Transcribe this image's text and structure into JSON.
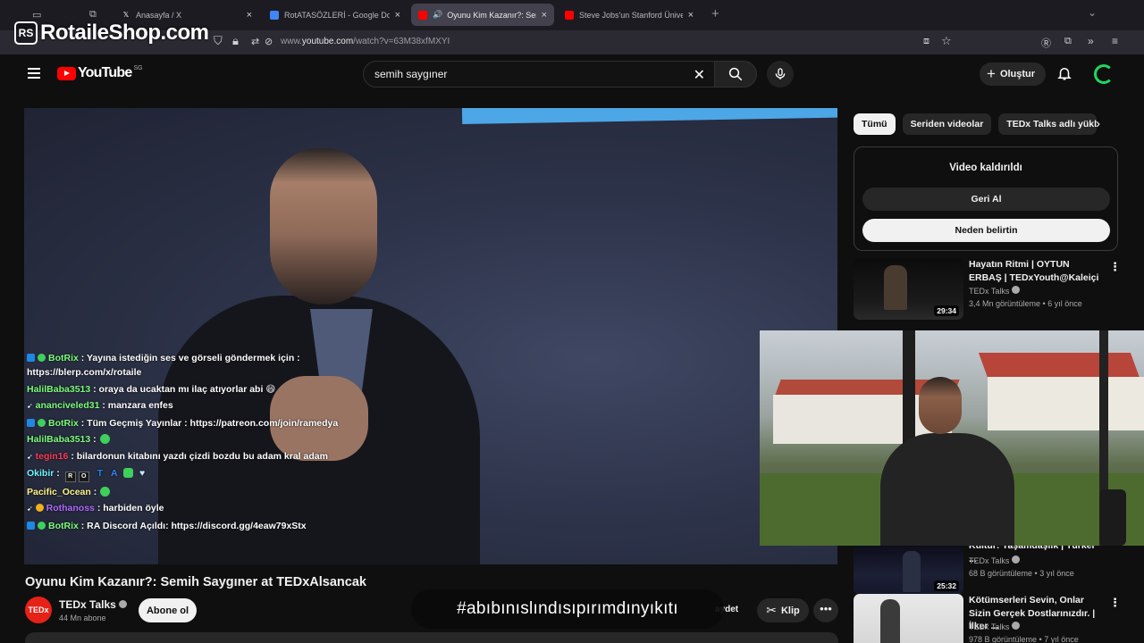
{
  "browser": {
    "tabs": [
      {
        "title": "Anasayfa / X",
        "favicon": "x-logo"
      },
      {
        "title": "RotATASÖZLERİ - Google Doküman",
        "favicon": "google-docs"
      },
      {
        "title": "Oyunu Kim Kazanır?: Semih",
        "favicon": "youtube",
        "active": true
      },
      {
        "title": "Steve Jobs'un Stanford Üniversitesi",
        "favicon": "youtube"
      }
    ],
    "url_prefix": "www.",
    "url_domain": "youtube.com",
    "url_path": "/watch?v=63M38xfMXYI"
  },
  "watermark": {
    "badge": "RS",
    "text": "RotaileShop.com"
  },
  "youtube": {
    "logo_text": "YouTube",
    "logo_country": "SG",
    "search_query": "semih saygıner",
    "create_label": "Oluştur"
  },
  "chat": [
    {
      "user": "BotRix",
      "color": "green",
      "badges": true,
      "text": ": Yayına istediğin ses ve görseli göndermek için : https://blerp.com/x/rotaile"
    },
    {
      "user": "HalilBaba3513",
      "color": "green",
      "text": ": oraya da ucaktan mı ilaç atıyorlar abi",
      "emoji": "😄"
    },
    {
      "user": "ananciveled31",
      "color": "green",
      "text": ": manzara enfes"
    },
    {
      "user": "BotRix",
      "color": "green",
      "badges": true,
      "text": ": Tüm Geçmiş Yayınlar : https://patreon.com/join/ramedya"
    },
    {
      "user": "HalilBaba3513",
      "color": "green",
      "text": ":"
    },
    {
      "user": "tegin16",
      "color": "red",
      "text": ": bilardonun kitabını yazdı çizdi bozdu bu adam kral adam"
    },
    {
      "user": "Okibir",
      "color": "cyan",
      "text": ":"
    },
    {
      "user": "Pacific_Ocean",
      "color": "yellow",
      "text": ":"
    },
    {
      "user": "Rothanoss",
      "color": "purple",
      "text": ": harbiden öyle"
    },
    {
      "user": "BotRix",
      "color": "green",
      "badges": true,
      "text": ": RA Discord Açıldı: https://discord.gg/4eaw79xStx"
    }
  ],
  "video": {
    "title": "Oyunu Kim Kazanır?: Semih Saygıner at TEDxAlsancak",
    "channel": "TEDx Talks",
    "channel_avatar": "TEDx",
    "subscribers": "44 Mn abone",
    "subscribe_label": "Abone ol",
    "save_fragment": "aydet",
    "clip_label": "Klip",
    "hashtag_overlay": "#abıbınıslındısıpırımdınyıkıtı"
  },
  "sidebar": {
    "chips": [
      "Tümü",
      "Seriden videolar",
      "TEDx Talks adlı yükleyici"
    ],
    "removed": {
      "title": "Video kaldırıldı",
      "undo": "Geri Al",
      "why": "Neden belirtin"
    },
    "recommendations": [
      {
        "title": "Hayatın Ritmi | OYTUN ERBAŞ | TEDxYouth@Kaleiçi",
        "channel": "TEDx Talks",
        "meta": "3,4 Mn görüntüleme • 6 yıl önce",
        "duration": "29:34"
      },
      {
        "title": "Kültür: Yaşamdaşlık | Türker ...",
        "channel": "TEDx Talks",
        "meta": "68 B görüntüleme • 3 yıl önce",
        "duration": "25:32"
      },
      {
        "title": "Kötümserleri Sevin, Onlar Sizin Gerçek Dostlarınızdır. | İlker ...",
        "channel": "TEDx Talks",
        "meta": "978 B görüntüleme • 7 yıl önce",
        "duration": ""
      }
    ]
  }
}
